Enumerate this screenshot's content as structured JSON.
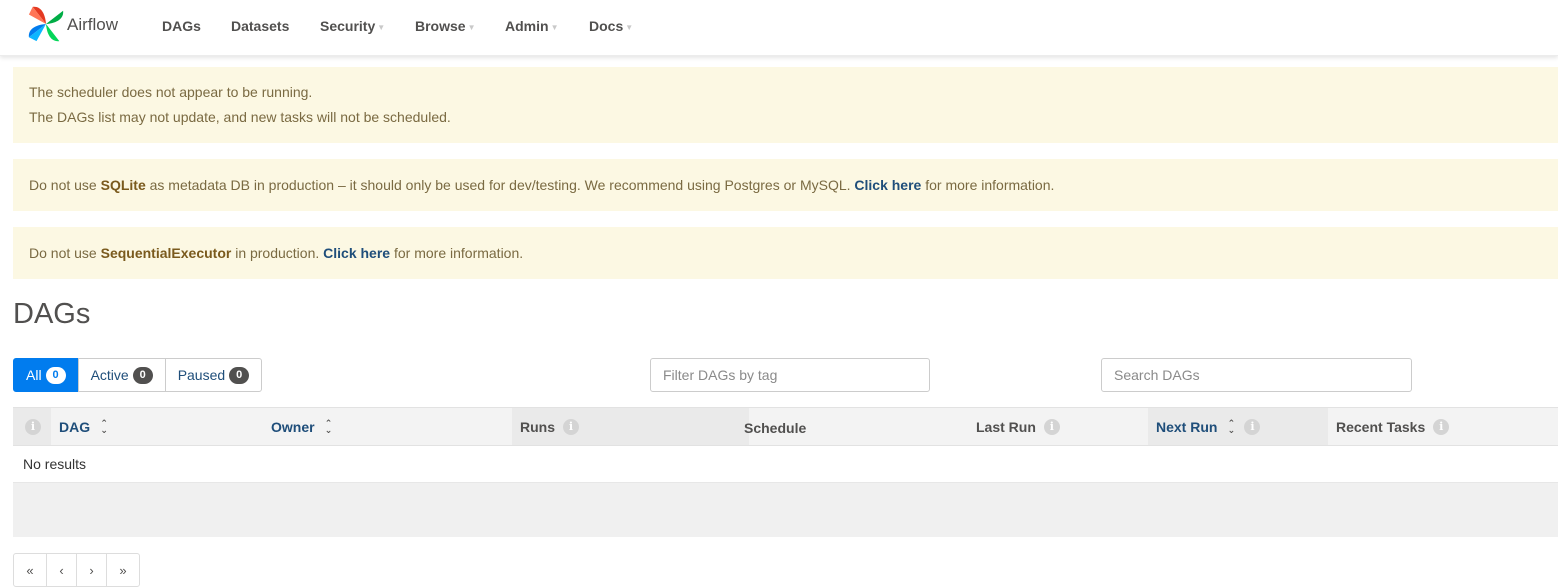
{
  "navbar": {
    "brand": "Airflow",
    "items": [
      "DAGs",
      "Datasets",
      "Security",
      "Browse",
      "Admin",
      "Docs"
    ]
  },
  "alerts": {
    "scheduler": {
      "line1": "The scheduler does not appear to be running.",
      "line2": "The DAGs list may not update, and new tasks will not be scheduled."
    },
    "sqlite": {
      "pre": "Do not use ",
      "strong": "SQLite",
      "mid": " as metadata DB in production – it should only be used for dev/testing. We recommend using Postgres or MySQL. ",
      "link": "Click here",
      "post": " for more information."
    },
    "executor": {
      "pre": "Do not use ",
      "strong": "SequentialExecutor",
      "mid": " in production. ",
      "link": "Click here",
      "post": " for more information."
    }
  },
  "page_title": "DAGs",
  "status_tabs": [
    {
      "label": "All",
      "count": "0"
    },
    {
      "label": "Active",
      "count": "0"
    },
    {
      "label": "Paused",
      "count": "0"
    }
  ],
  "filters": {
    "tag_placeholder": "Filter DAGs by tag",
    "search_placeholder": "Search DAGs"
  },
  "table": {
    "columns": [
      "DAG",
      "Owner",
      "Runs",
      "Schedule",
      "Last Run",
      "Next Run",
      "Recent Tasks"
    ],
    "empty_message": "No results"
  },
  "pagination": [
    "«",
    "‹",
    "›",
    "»"
  ],
  "colors": {
    "accent": "#017cee",
    "alert_bg": "#fcf8e3",
    "link": "#1f4e7a"
  }
}
